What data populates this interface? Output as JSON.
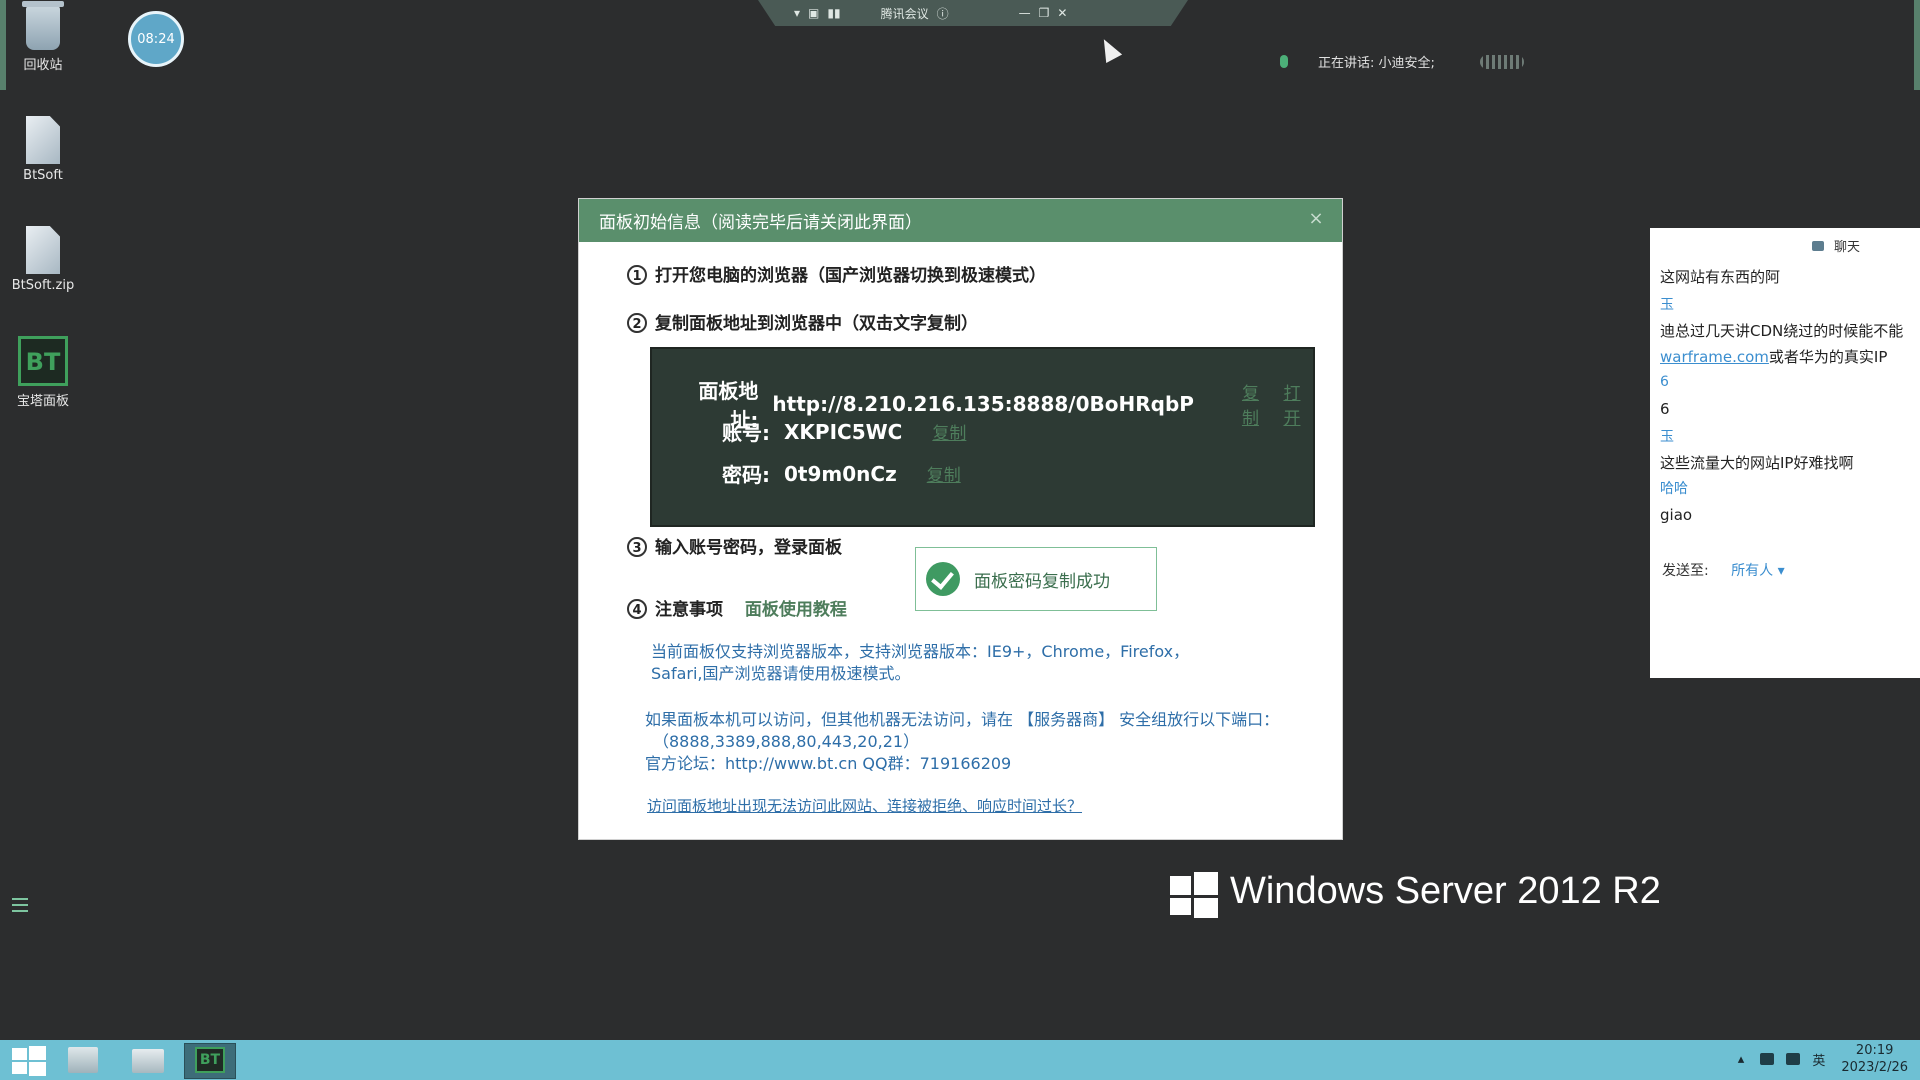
{
  "desktop": {
    "icons": [
      {
        "label": "回收站"
      },
      {
        "label": "BtSoft"
      },
      {
        "label": "BtSoft.zip"
      },
      {
        "label": "宝塔面板"
      }
    ],
    "clock_bubble": "08:24"
  },
  "meeting_bar": {
    "title": "腾讯会议"
  },
  "speaking": {
    "text": "正在讲话: 小迪安全;"
  },
  "dialog": {
    "title": "面板初始信息（阅读完毕后请关闭此界面）",
    "close": "×",
    "step1": {
      "num": "1",
      "text": "打开您电脑的浏览器（国产浏览器切换到极速模式）"
    },
    "step2": {
      "num": "2",
      "text": "复制面板地址到浏览器中（双击文字复制）"
    },
    "panel": {
      "address_label": "面板地址:",
      "address_value": "http://8.210.216.135:8888/0BoHRqbP",
      "copy": "复制",
      "open": "打开",
      "account_label": "账号:",
      "account_value": "XKPIC5WC",
      "password_label": "密码:",
      "password_value": "0t9m0nCz"
    },
    "step3": {
      "num": "3",
      "text": "输入账号密码，登录面板"
    },
    "toast": "面板密码复制成功",
    "step4": {
      "num": "4",
      "text": "注意事项",
      "tutorial": "面板使用教程"
    },
    "notes": [
      "当前面板仅支持浏览器版本，支持浏览器版本：IE9+，Chrome，Firefox，",
      "Safari,国产浏览器请使用极速模式。",
      "如果面板本机可以访问，但其他机器无法访问，请在 【服务器商】 安全组放行以下端口：",
      "（8888,3389,888,80,443,20,21）",
      "官方论坛：http://www.bt.cn  QQ群：719166209"
    ],
    "bottom_link": "访问面板地址出现无法访问此网站、连接被拒绝、响应时间过长？"
  },
  "windows_brand": "Windows Server 2012 R2",
  "chat": {
    "title": "聊天",
    "messages": [
      {
        "type": "text",
        "text": "这网站有东西的阿"
      },
      {
        "type": "sender",
        "text": "玉"
      },
      {
        "type": "text",
        "text": "迪总过几天讲CDN绕过的时候能不能"
      },
      {
        "type": "mixed",
        "link": "warframe.com",
        "text": "或者华为的真实IP"
      },
      {
        "type": "sender",
        "text": "6"
      },
      {
        "type": "text",
        "text": "6"
      },
      {
        "type": "sender",
        "text": "玉"
      },
      {
        "type": "text",
        "text": "这些流量大的网站IP好难找啊"
      },
      {
        "type": "sender",
        "text": "哈哈"
      },
      {
        "type": "text",
        "text": "giao"
      }
    ],
    "send_to_label": "发送至:",
    "send_to_value": "所有人 ▾"
  },
  "taskbar": {
    "bt_label": "BT",
    "lang": "英",
    "time": "20:19",
    "date": "2023/2/26"
  }
}
